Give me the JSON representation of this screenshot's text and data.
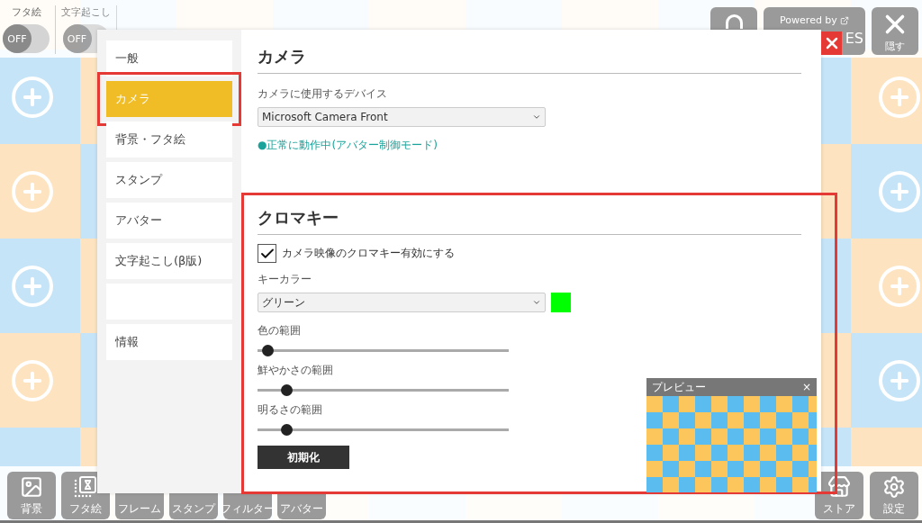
{
  "top_toggles": [
    {
      "label": "フタ絵",
      "state": "OFF",
      "on": false,
      "disabled": false
    },
    {
      "label": "文字起こし",
      "state": "OFF",
      "on": false,
      "disabled": true
    }
  ],
  "top_buttons": [
    {
      "kind": "arch"
    },
    {
      "kind": "powered",
      "caption": "Powered by",
      "label": "ES"
    },
    {
      "kind": "hide",
      "label": "隠す"
    }
  ],
  "bottom_left": [
    {
      "kind": "image",
      "label": "背景"
    },
    {
      "kind": "frame",
      "label": "フタ絵"
    },
    {
      "kind": "covered",
      "label": "フレーム"
    },
    {
      "kind": "covered",
      "label": "スタンプ"
    },
    {
      "kind": "covered",
      "label": "フィルター"
    },
    {
      "kind": "covered",
      "label": "アバター"
    }
  ],
  "bottom_right": [
    {
      "kind": "store",
      "label": "ストア"
    },
    {
      "kind": "settings",
      "label": "設定"
    }
  ],
  "dialog": {
    "sidebar": [
      {
        "label": "一般",
        "selected": false,
        "highlighted": false
      },
      {
        "label": "カメラ",
        "selected": true,
        "highlighted": true
      },
      {
        "label": "背景・フタ絵",
        "selected": false,
        "highlighted": false
      },
      {
        "label": "スタンプ",
        "selected": false,
        "highlighted": false
      },
      {
        "label": "アバター",
        "selected": false,
        "highlighted": false
      },
      {
        "label": "文字起こし(β版)",
        "selected": false,
        "highlighted": false
      },
      {
        "selected": false,
        "highlighted": false
      },
      {
        "label": "情報",
        "selected": false,
        "highlighted": false
      }
    ],
    "camera": {
      "title": "カメラ",
      "device_label": "カメラに使用するデバイス",
      "device": "Microsoft Camera Front",
      "status": "●正常に動作中(アバター制御モード)"
    },
    "chroma": {
      "title": "クロマキー",
      "highlighted": true,
      "enable_label": "カメラ映像のクロマキー有効にする",
      "enabled": true,
      "key_label": "キーカラー",
      "key_color": "グリーン",
      "swatch": {
        "color": "#00ff00"
      },
      "sliders": [
        {
          "label": "色の範囲",
          "level": 0.04
        },
        {
          "label": "鮮やかさの範囲",
          "level": 0.115
        },
        {
          "label": "明るさの範囲",
          "level": 0.115
        }
      ],
      "reset": "初期化"
    },
    "preview": {
      "title": "プレビュー",
      "close": "×"
    }
  }
}
